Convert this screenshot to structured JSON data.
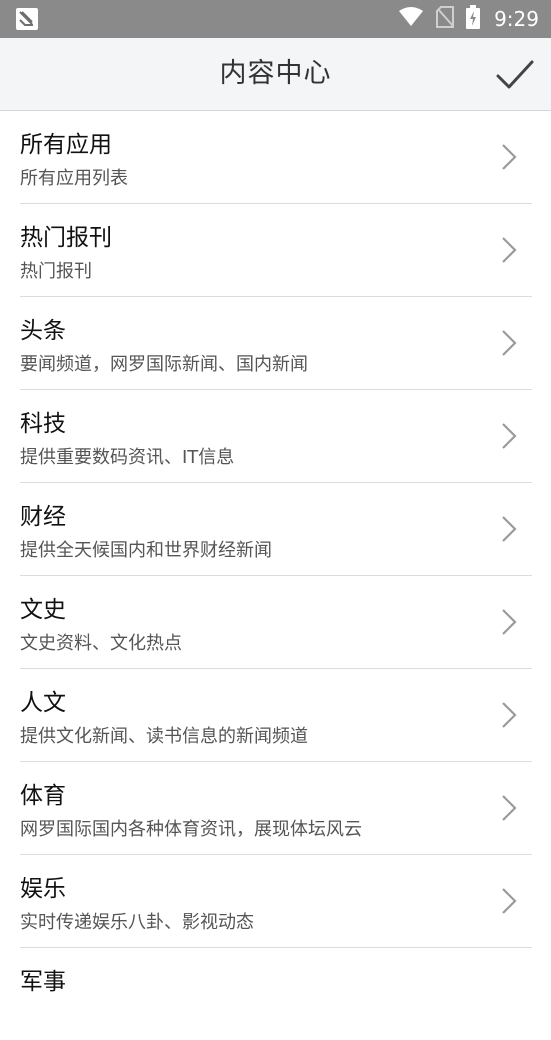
{
  "status_bar": {
    "time": "9:29",
    "icons": [
      "app-notification-icon",
      "wifi-icon",
      "no-sim-icon",
      "battery-charging-icon"
    ]
  },
  "header": {
    "title": "内容中心",
    "confirm_icon": "check-icon"
  },
  "items": [
    {
      "title": "所有应用",
      "subtitle": "所有应用列表"
    },
    {
      "title": "热门报刊",
      "subtitle": "热门报刊"
    },
    {
      "title": "头条",
      "subtitle": "要闻频道，网罗国际新闻、国内新闻"
    },
    {
      "title": "科技",
      "subtitle": "提供重要数码资讯、IT信息"
    },
    {
      "title": "财经",
      "subtitle": "提供全天候国内和世界财经新闻"
    },
    {
      "title": "文史",
      "subtitle": "文史资料、文化热点"
    },
    {
      "title": "人文",
      "subtitle": "提供文化新闻、读书信息的新闻频道"
    },
    {
      "title": "体育",
      "subtitle": "网罗国际国内各种体育资讯，展现体坛风云"
    },
    {
      "title": "娱乐",
      "subtitle": "实时传递娱乐八卦、影视动态"
    },
    {
      "title": "军事",
      "subtitle": ""
    }
  ],
  "colors": {
    "status_bar": "#8a8a8a",
    "header_bg": "#f4f5f7",
    "divider": "#dcdcdc",
    "chevron": "#9a9a9a"
  }
}
